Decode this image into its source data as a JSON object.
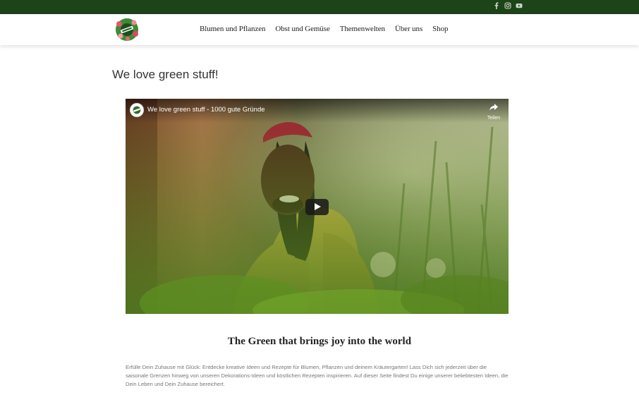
{
  "social": {
    "icons": [
      "facebook-icon",
      "instagram-icon",
      "youtube-icon"
    ],
    "color": "#c9d4c6"
  },
  "nav": {
    "items": [
      {
        "label": "Blumen und Pflanzen"
      },
      {
        "label": "Obst und Gemüse"
      },
      {
        "label": "Themenwelten"
      },
      {
        "label": "Über uns"
      },
      {
        "label": "Shop"
      }
    ]
  },
  "page": {
    "title": "We love green stuff!"
  },
  "video": {
    "title": "We love green stuff - 1000 gute Gründe",
    "share_label": "Teilen"
  },
  "section": {
    "heading": "The Green that brings joy into the world",
    "text": "Erfülle Dein Zuhause mit Glück: Entdecke kreative Ideen und Rezepte für Blumen, Pflanzen und deinem Kräutergarten! Lass Dich sich jederzeit über die saisonale Grenzen hinweg von unseren Dekorations-Ideen und köstlichen Rezepten inspirieren. Auf dieser Seite findest Du einige unserer beliebtesten Ideen, die Dein Leben und Dein Zuhause bereichert."
  },
  "colors": {
    "topbar": "#1d4318",
    "accent": "#2e6b2a"
  }
}
